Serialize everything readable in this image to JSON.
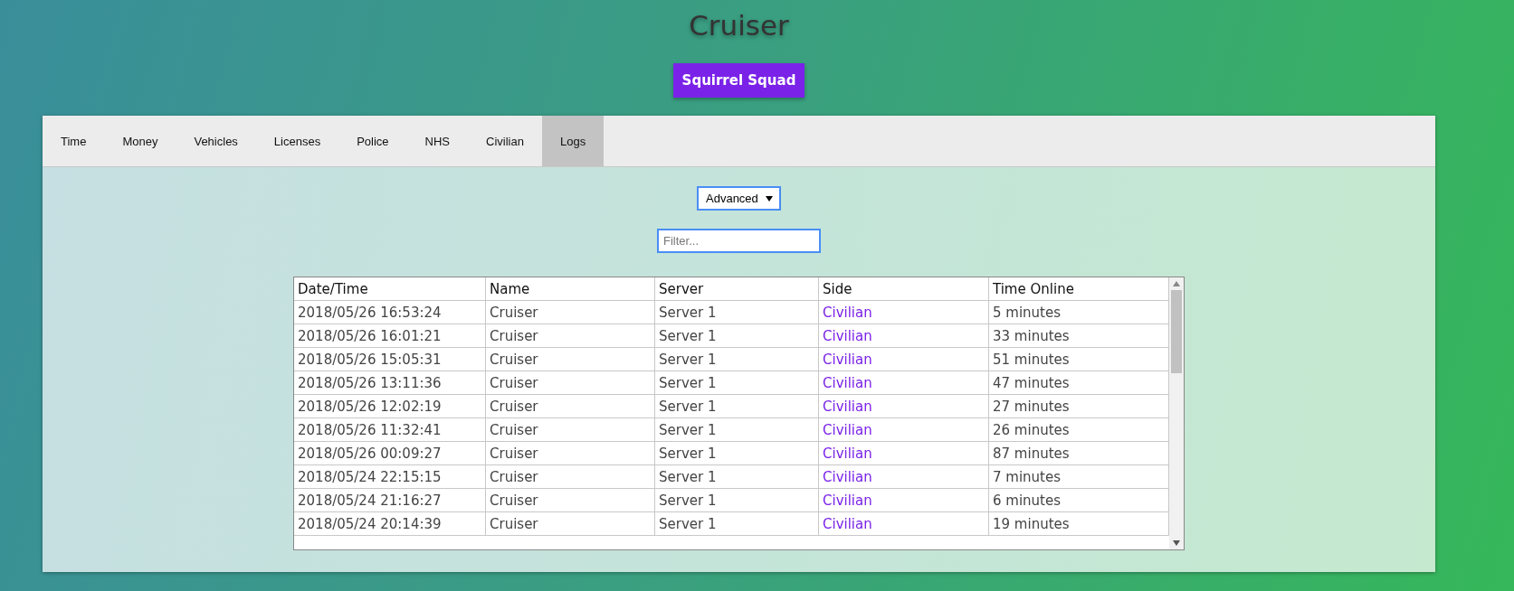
{
  "title": "Cruiser",
  "group_button": "Squirrel Squad",
  "tabs": [
    {
      "label": "Time",
      "selected": false
    },
    {
      "label": "Money",
      "selected": false
    },
    {
      "label": "Vehicles",
      "selected": false
    },
    {
      "label": "Licenses",
      "selected": false
    },
    {
      "label": "Police",
      "selected": false
    },
    {
      "label": "NHS",
      "selected": false
    },
    {
      "label": "Civilian",
      "selected": false
    },
    {
      "label": "Logs",
      "selected": true
    }
  ],
  "view_select": {
    "value": "Advanced"
  },
  "filter": {
    "placeholder": "Filter..."
  },
  "table": {
    "columns": [
      "Date/Time",
      "Name",
      "Server",
      "Side",
      "Time Online"
    ],
    "rows": [
      [
        "2018/05/26 16:53:24",
        "Cruiser",
        "Server 1",
        "Civilian",
        "5 minutes"
      ],
      [
        "2018/05/26 16:01:21",
        "Cruiser",
        "Server 1",
        "Civilian",
        "33 minutes"
      ],
      [
        "2018/05/26 15:05:31",
        "Cruiser",
        "Server 1",
        "Civilian",
        "51 minutes"
      ],
      [
        "2018/05/26 13:11:36",
        "Cruiser",
        "Server 1",
        "Civilian",
        "47 minutes"
      ],
      [
        "2018/05/26 12:02:19",
        "Cruiser",
        "Server 1",
        "Civilian",
        "27 minutes"
      ],
      [
        "2018/05/26 11:32:41",
        "Cruiser",
        "Server 1",
        "Civilian",
        "26 minutes"
      ],
      [
        "2018/05/26 00:09:27",
        "Cruiser",
        "Server 1",
        "Civilian",
        "87 minutes"
      ],
      [
        "2018/05/24 22:15:15",
        "Cruiser",
        "Server 1",
        "Civilian",
        "7 minutes"
      ],
      [
        "2018/05/24 21:16:27",
        "Cruiser",
        "Server 1",
        "Civilian",
        "6 minutes"
      ],
      [
        "2018/05/24 20:14:39",
        "Cruiser",
        "Server 1",
        "Civilian",
        "19 minutes"
      ]
    ]
  }
}
